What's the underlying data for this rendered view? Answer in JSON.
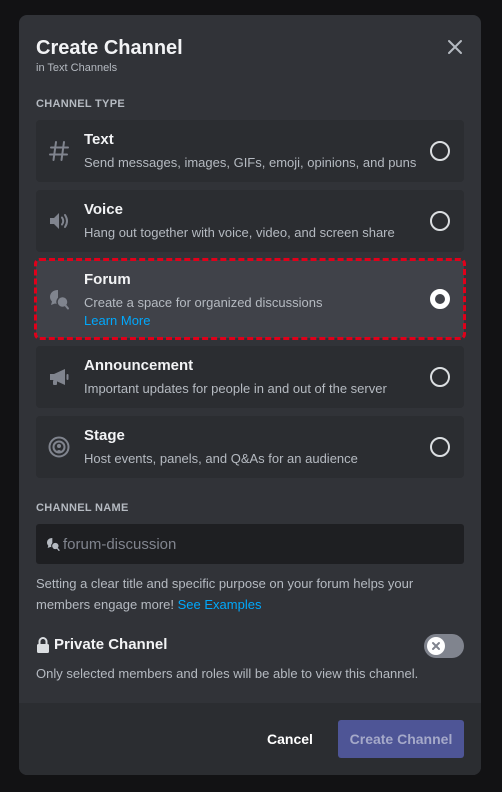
{
  "modal": {
    "title": "Create Channel",
    "subtitle": "in Text Channels",
    "close_icon": "close-icon"
  },
  "channel_type": {
    "label": "CHANNEL TYPE",
    "selected": "forum",
    "options": [
      {
        "id": "text",
        "icon": "hash-icon",
        "name": "Text",
        "description": "Send messages, images, GIFs, emoji, opinions, and puns",
        "selected": false
      },
      {
        "id": "voice",
        "icon": "speaker-icon",
        "name": "Voice",
        "description": "Hang out together with voice, video, and screen share",
        "selected": false
      },
      {
        "id": "forum",
        "icon": "forum-icon",
        "name": "Forum",
        "description": "Create a space for organized discussions",
        "link": "Learn More",
        "selected": true
      },
      {
        "id": "announcement",
        "icon": "megaphone-icon",
        "name": "Announcement",
        "description": "Important updates for people in and out of the server",
        "selected": false
      },
      {
        "id": "stage",
        "icon": "stage-icon",
        "name": "Stage",
        "description": "Host events, panels, and Q&As for an audience",
        "selected": false
      }
    ]
  },
  "channel_name": {
    "label": "CHANNEL NAME",
    "value": "",
    "placeholder": "forum-discussion",
    "icon": "forum-icon"
  },
  "hint": {
    "text": "Setting a clear title and specific purpose on your forum helps your members engage more!",
    "link": "See Examples"
  },
  "private_channel": {
    "label": "Private Channel",
    "icon": "lock-icon",
    "enabled": false,
    "description": "Only selected members and roles will be able to view this channel."
  },
  "footer": {
    "cancel_label": "Cancel",
    "create_label": "Create Channel",
    "create_enabled": false
  },
  "colors": {
    "background": "#313338",
    "accent_link": "#00a8fc",
    "selection_outline": "#e0001a",
    "primary_button": "#4e5596"
  }
}
